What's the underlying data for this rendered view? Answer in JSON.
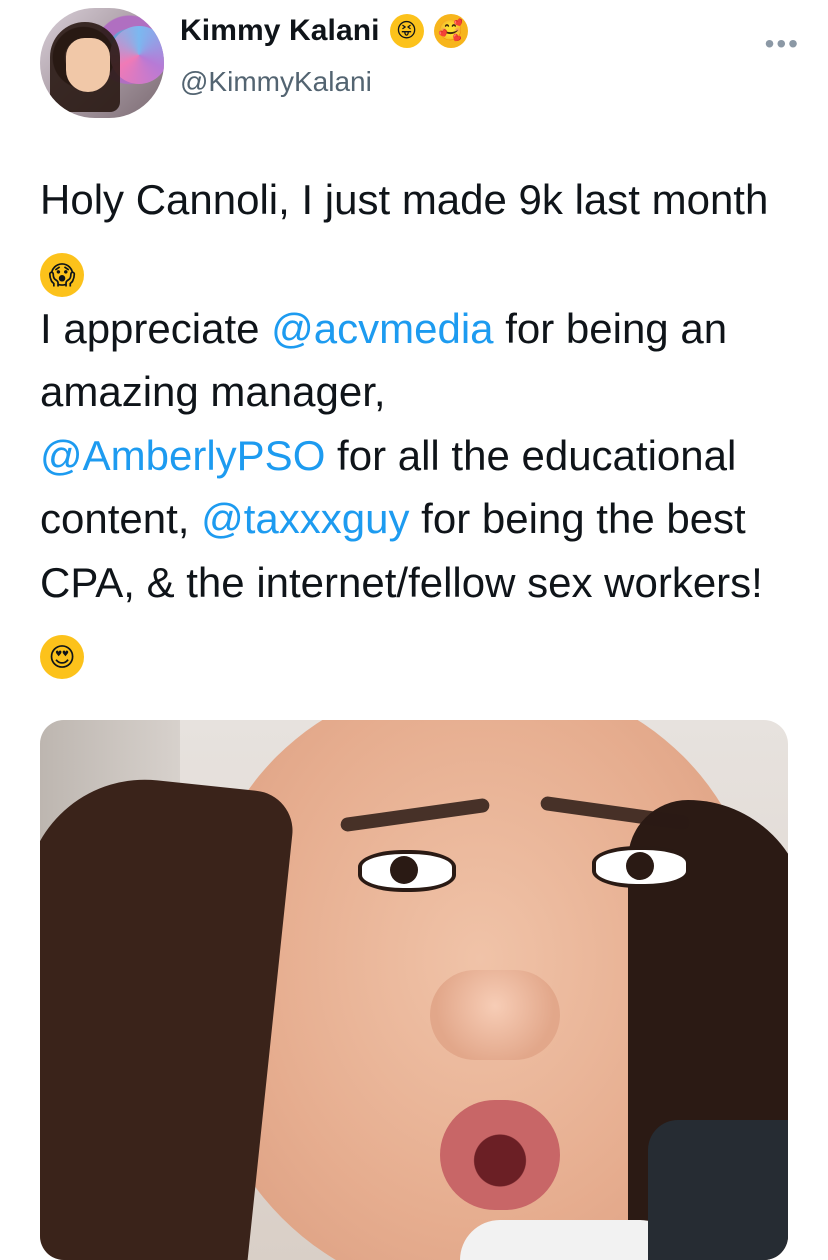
{
  "author": {
    "display_name": "Kimmy Kalani",
    "handle": "@KimmyKalani",
    "name_emojis": [
      {
        "name": "squinting-tongue-face-emoji",
        "glyph": "😝"
      },
      {
        "name": "smiling-face-with-hearts-emoji",
        "glyph": "🥰"
      }
    ]
  },
  "menu": {
    "more_glyph": "•••"
  },
  "tweet": {
    "line1": "Holy Cannoli, I just made 9k last month ",
    "emoji_scream": "😱",
    "text_appreciate": "I appreciate ",
    "mention_1": "@acvmedia",
    "text_after_1": " for being an amazing manager,",
    "mention_2": "@AmberlyPSO",
    "text_after_2": " for all the educational content, ",
    "mention_3": "@taxxxguy",
    "text_after_3": " for being the best CPA, & the internet/fellow sex workers! ",
    "emoji_heart_eyes": "😍"
  },
  "colors": {
    "text": "#0f1419",
    "secondary": "#536471",
    "mention": "#1d9bf0"
  }
}
